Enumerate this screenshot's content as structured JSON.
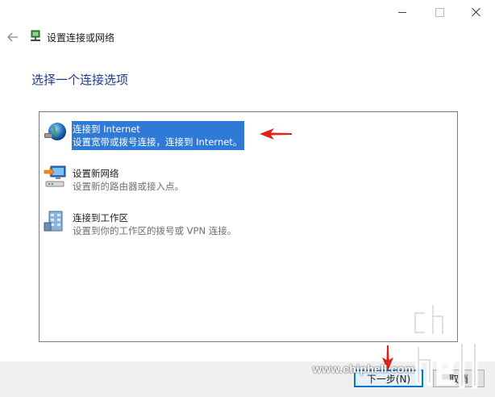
{
  "window": {
    "title": "设置连接或网络",
    "heading": "选择一个连接选项"
  },
  "options": [
    {
      "title": "连接到 Internet",
      "desc": "设置宽带或拨号连接，连接到 Internet。",
      "selected": true,
      "icon": "globe-network-icon"
    },
    {
      "title": "设置新网络",
      "desc": "设置新的路由器或接入点。",
      "selected": false,
      "icon": "router-computer-icon"
    },
    {
      "title": "连接到工作区",
      "desc": "设置到你的工作区的拨号或 VPN 连接。",
      "selected": false,
      "icon": "workplace-building-icon"
    }
  ],
  "buttons": {
    "next": "下一步(N)",
    "cancel": "取消"
  },
  "watermark": {
    "url": "www.chiphell.com",
    "logo": "chiphell"
  },
  "colors": {
    "selection": "#2f7ad6",
    "heading": "#1f3a8a",
    "annotation": "#e0201a"
  }
}
